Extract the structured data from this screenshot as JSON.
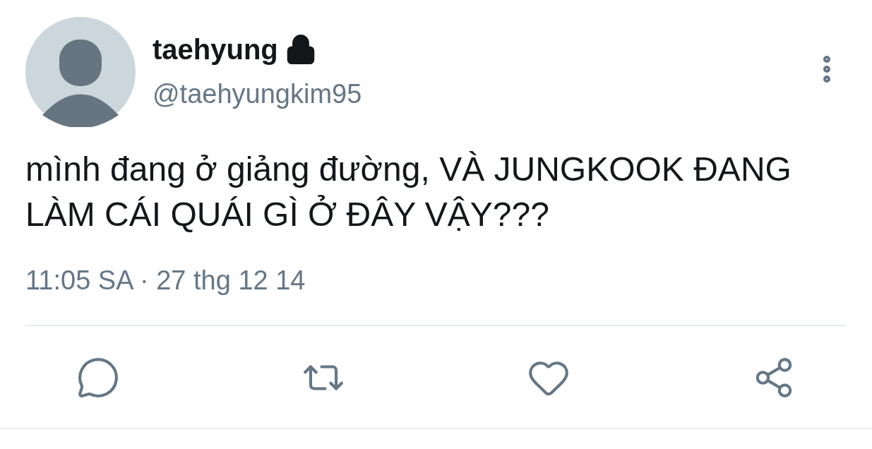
{
  "user": {
    "name": "taehyung",
    "locked": true,
    "handle": "@taehyungkim95"
  },
  "tweet": {
    "text": "mình đang ở giảng đường, VÀ JUNGKOOK ĐANG LÀM CÁI QUÁI GÌ Ở ĐÂY VẬY???",
    "timestamp": "11:05 SA · 27 thg 12 14"
  },
  "actions": [
    {
      "kind": "reply"
    },
    {
      "kind": "retweet"
    },
    {
      "kind": "like"
    },
    {
      "kind": "share"
    }
  ]
}
